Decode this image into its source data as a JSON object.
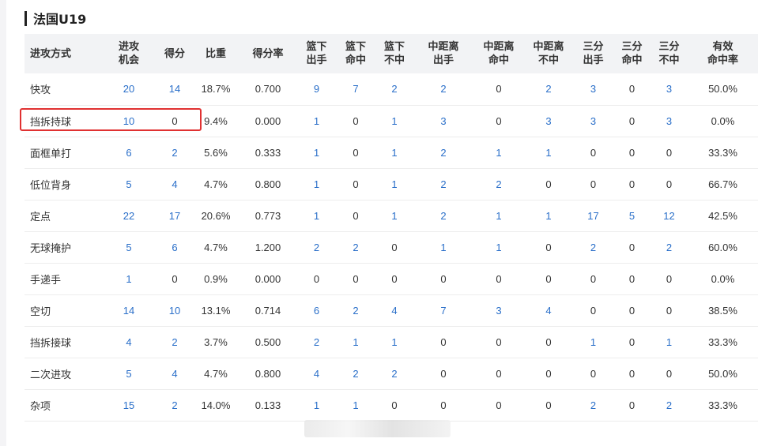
{
  "section": {
    "title": "法国U19"
  },
  "columns": [
    {
      "key": "type",
      "label": "进攻方式"
    },
    {
      "key": "chances",
      "label": "进攻\n机会"
    },
    {
      "key": "points",
      "label": "得分"
    },
    {
      "key": "share",
      "label": "比重"
    },
    {
      "key": "ppp",
      "label": "得分率"
    },
    {
      "key": "rim_att",
      "label": "篮下\n出手"
    },
    {
      "key": "rim_made",
      "label": "篮下\n命中"
    },
    {
      "key": "rim_miss",
      "label": "篮下\n不中"
    },
    {
      "key": "mid_att",
      "label": "中距离\n出手"
    },
    {
      "key": "mid_made",
      "label": "中距离\n命中"
    },
    {
      "key": "mid_miss",
      "label": "中距离\n不中"
    },
    {
      "key": "three_att",
      "label": "三分\n出手"
    },
    {
      "key": "three_made",
      "label": "三分\n命中"
    },
    {
      "key": "three_miss",
      "label": "三分\n不中"
    },
    {
      "key": "efg",
      "label": "有效\n命中率"
    }
  ],
  "rows": [
    {
      "type": "快攻",
      "chances": "20",
      "points": "14",
      "share": "18.7%",
      "ppp": "0.700",
      "rim_att": "9",
      "rim_made": "7",
      "rim_miss": "2",
      "mid_att": "2",
      "mid_made": "0",
      "mid_miss": "2",
      "three_att": "3",
      "three_made": "0",
      "three_miss": "3",
      "efg": "50.0%"
    },
    {
      "type": "挡拆持球",
      "chances": "10",
      "points": "0",
      "share": "9.4%",
      "ppp": "0.000",
      "rim_att": "1",
      "rim_made": "0",
      "rim_miss": "1",
      "mid_att": "3",
      "mid_made": "0",
      "mid_miss": "3",
      "three_att": "3",
      "three_made": "0",
      "three_miss": "3",
      "efg": "0.0%"
    },
    {
      "type": "面框单打",
      "chances": "6",
      "points": "2",
      "share": "5.6%",
      "ppp": "0.333",
      "rim_att": "1",
      "rim_made": "0",
      "rim_miss": "1",
      "mid_att": "2",
      "mid_made": "1",
      "mid_miss": "1",
      "three_att": "0",
      "three_made": "0",
      "three_miss": "0",
      "efg": "33.3%"
    },
    {
      "type": "低位背身",
      "chances": "5",
      "points": "4",
      "share": "4.7%",
      "ppp": "0.800",
      "rim_att": "1",
      "rim_made": "0",
      "rim_miss": "1",
      "mid_att": "2",
      "mid_made": "2",
      "mid_miss": "0",
      "three_att": "0",
      "three_made": "0",
      "three_miss": "0",
      "efg": "66.7%"
    },
    {
      "type": "定点",
      "chances": "22",
      "points": "17",
      "share": "20.6%",
      "ppp": "0.773",
      "rim_att": "1",
      "rim_made": "0",
      "rim_miss": "1",
      "mid_att": "2",
      "mid_made": "1",
      "mid_miss": "1",
      "three_att": "17",
      "three_made": "5",
      "three_miss": "12",
      "efg": "42.5%"
    },
    {
      "type": "无球掩护",
      "chances": "5",
      "points": "6",
      "share": "4.7%",
      "ppp": "1.200",
      "rim_att": "2",
      "rim_made": "2",
      "rim_miss": "0",
      "mid_att": "1",
      "mid_made": "1",
      "mid_miss": "0",
      "three_att": "2",
      "three_made": "0",
      "three_miss": "2",
      "efg": "60.0%"
    },
    {
      "type": "手递手",
      "chances": "1",
      "points": "0",
      "share": "0.9%",
      "ppp": "0.000",
      "rim_att": "0",
      "rim_made": "0",
      "rim_miss": "0",
      "mid_att": "0",
      "mid_made": "0",
      "mid_miss": "0",
      "three_att": "0",
      "three_made": "0",
      "three_miss": "0",
      "efg": "0.0%"
    },
    {
      "type": "空切",
      "chances": "14",
      "points": "10",
      "share": "13.1%",
      "ppp": "0.714",
      "rim_att": "6",
      "rim_made": "2",
      "rim_miss": "4",
      "mid_att": "7",
      "mid_made": "3",
      "mid_miss": "4",
      "three_att": "0",
      "three_made": "0",
      "three_miss": "0",
      "efg": "38.5%"
    },
    {
      "type": "挡拆接球",
      "chances": "4",
      "points": "2",
      "share": "3.7%",
      "ppp": "0.500",
      "rim_att": "2",
      "rim_made": "1",
      "rim_miss": "1",
      "mid_att": "0",
      "mid_made": "0",
      "mid_miss": "0",
      "three_att": "1",
      "three_made": "0",
      "three_miss": "1",
      "efg": "33.3%"
    },
    {
      "type": "二次进攻",
      "chances": "5",
      "points": "4",
      "share": "4.7%",
      "ppp": "0.800",
      "rim_att": "4",
      "rim_made": "2",
      "rim_miss": "2",
      "mid_att": "0",
      "mid_made": "0",
      "mid_miss": "0",
      "three_att": "0",
      "three_made": "0",
      "three_miss": "0",
      "efg": "50.0%"
    },
    {
      "type": "杂项",
      "chances": "15",
      "points": "2",
      "share": "14.0%",
      "ppp": "0.133",
      "rim_att": "1",
      "rim_made": "1",
      "rim_miss": "0",
      "mid_att": "0",
      "mid_made": "0",
      "mid_miss": "0",
      "three_att": "2",
      "three_made": "0",
      "three_miss": "2",
      "efg": "33.3%"
    }
  ],
  "colors": {
    "link": "#2a6fc9",
    "text": "#333333",
    "header_bg": "#f2f3f5",
    "highlight": "#e03131"
  }
}
